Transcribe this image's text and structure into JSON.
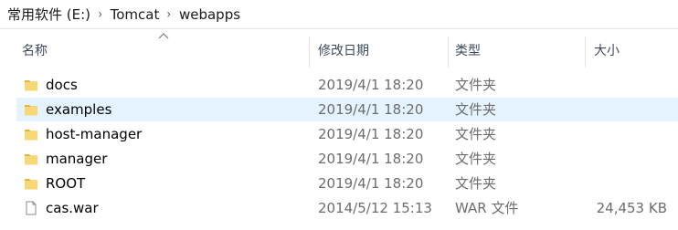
{
  "breadcrumb": {
    "items": [
      "常用软件 (E:)",
      "Tomcat",
      "webapps"
    ],
    "separator": "›"
  },
  "columns": {
    "name": "名称",
    "date": "修改日期",
    "type": "类型",
    "size": "大小"
  },
  "sort": {
    "column": "名称",
    "direction": "ascending"
  },
  "files": [
    {
      "name": "docs",
      "date": "2019/4/1 18:20",
      "type": "文件夹",
      "size": "",
      "icon": "folder-icon",
      "selected": false
    },
    {
      "name": "examples",
      "date": "2019/4/1 18:20",
      "type": "文件夹",
      "size": "",
      "icon": "folder-icon",
      "selected": true
    },
    {
      "name": "host-manager",
      "date": "2019/4/1 18:20",
      "type": "文件夹",
      "size": "",
      "icon": "folder-icon",
      "selected": false
    },
    {
      "name": "manager",
      "date": "2019/4/1 18:20",
      "type": "文件夹",
      "size": "",
      "icon": "folder-icon",
      "selected": false
    },
    {
      "name": "ROOT",
      "date": "2019/4/1 18:20",
      "type": "文件夹",
      "size": "",
      "icon": "folder-icon",
      "selected": false
    },
    {
      "name": "cas.war",
      "date": "2014/5/12 15:13",
      "type": "WAR 文件",
      "size": "24,453 KB",
      "icon": "file-icon",
      "selected": false
    }
  ],
  "colors": {
    "folder": "#f8d775",
    "folder_dark": "#e6b43c",
    "selection": "#e5f3ff",
    "header_text": "#3d4a5c",
    "meta_text": "#6d6d6d"
  }
}
